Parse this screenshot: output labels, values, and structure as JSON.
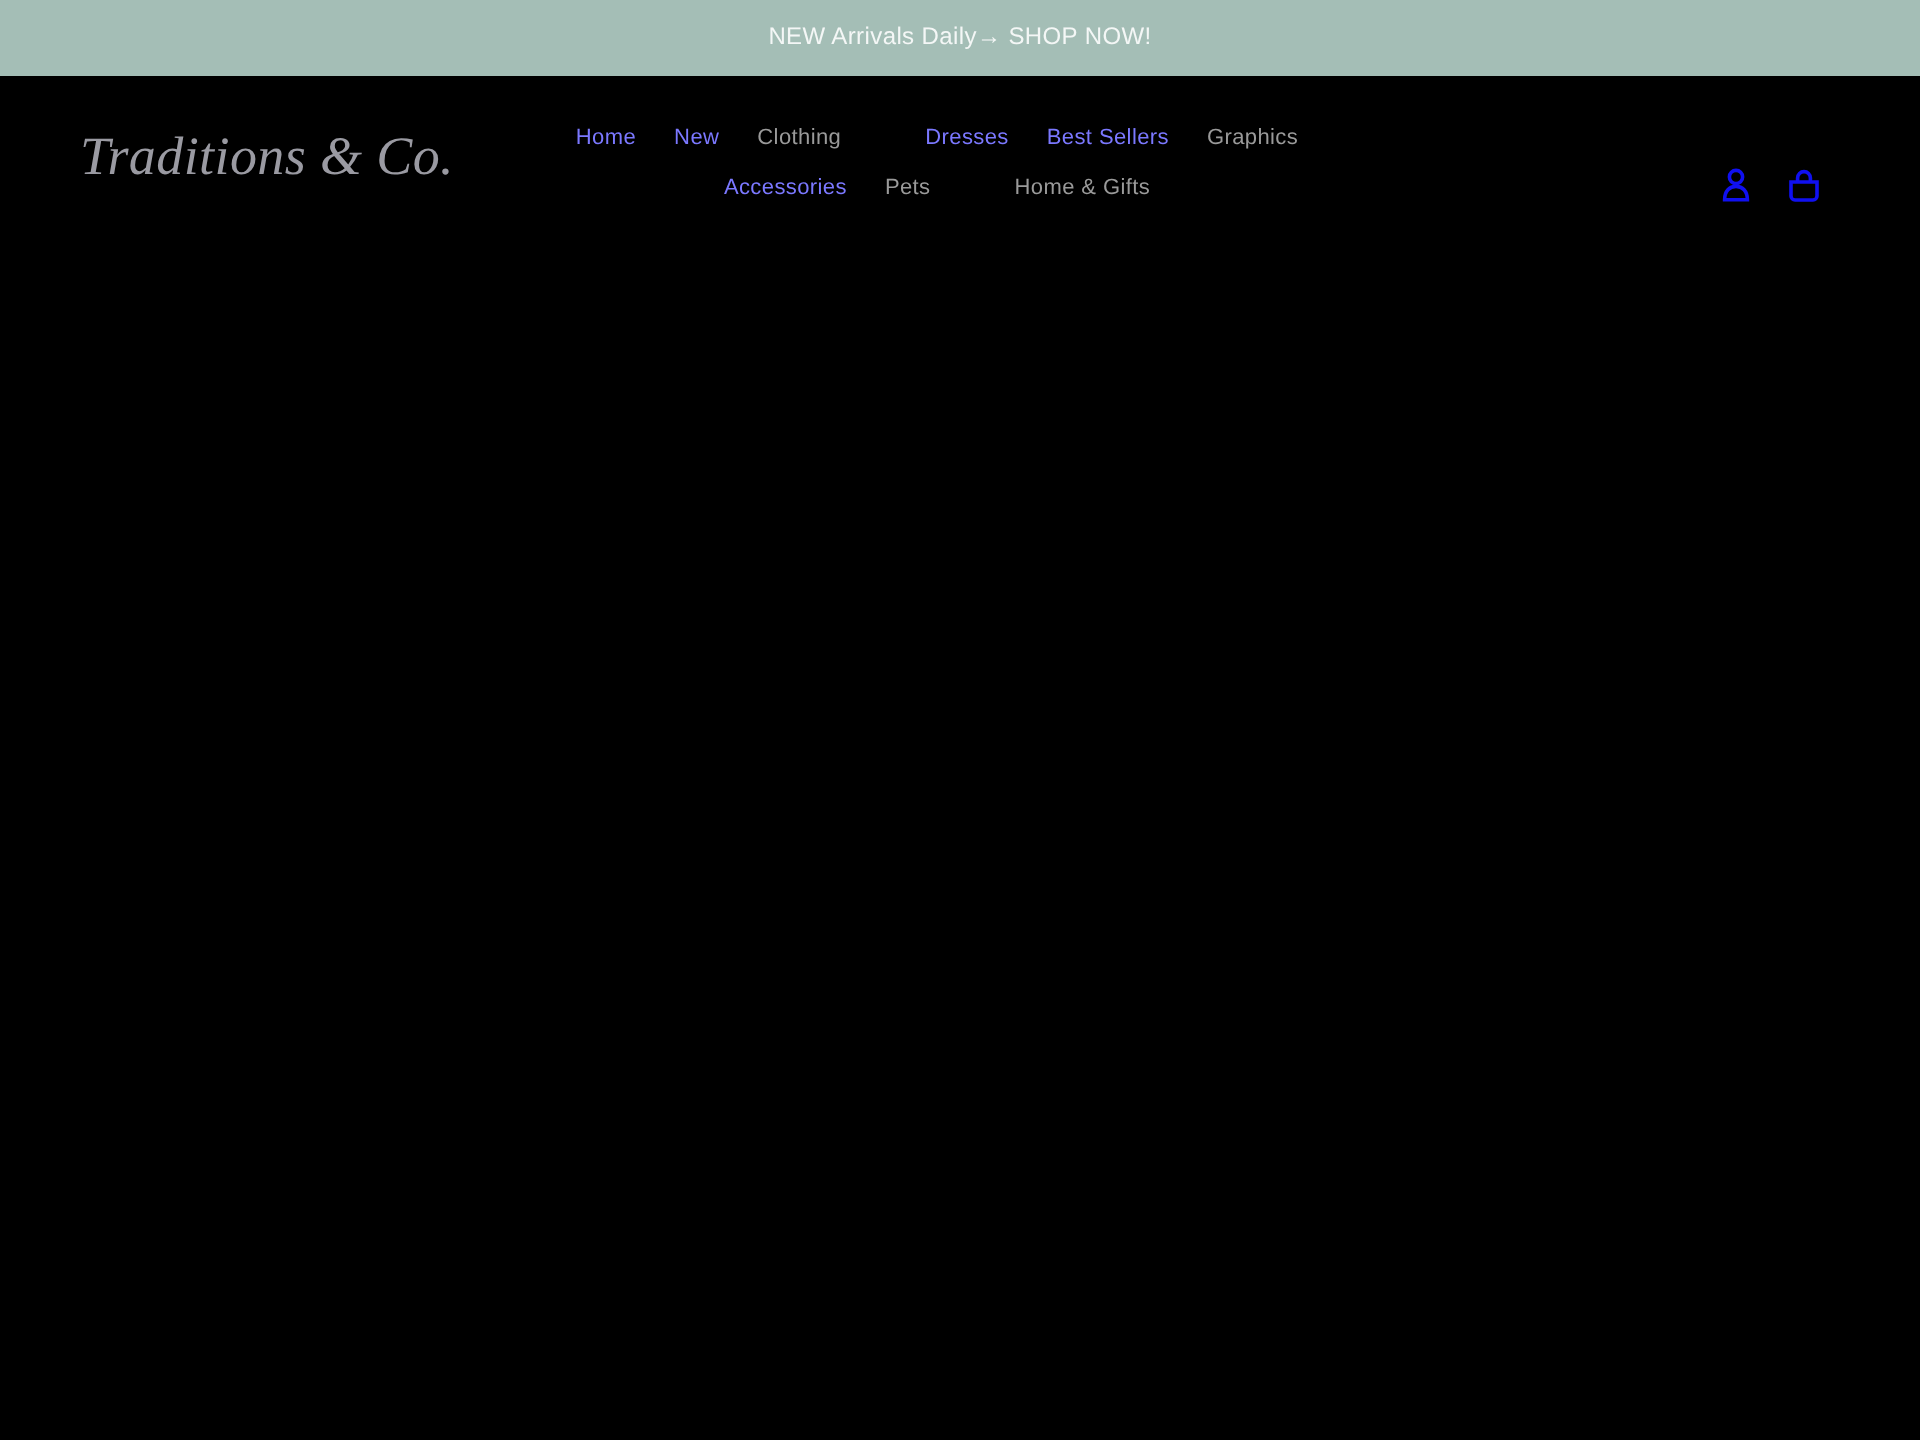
{
  "announcement": {
    "text": "NEW Arrivals Daily→ SHOP NOW!"
  },
  "header": {
    "logo": "Traditions & Co.",
    "nav": [
      {
        "label": "Home",
        "kind": "link"
      },
      {
        "label": "New",
        "kind": "link"
      },
      {
        "label": "Clothing",
        "kind": "dropdown"
      },
      {
        "label": "Dresses",
        "kind": "link"
      },
      {
        "label": "Best Sellers",
        "kind": "link"
      },
      {
        "label": "Graphics",
        "kind": "dropdown"
      },
      {
        "label": "Accessories",
        "kind": "link"
      },
      {
        "label": "Pets",
        "kind": "dropdown"
      },
      {
        "label": "Home & Gifts",
        "kind": "dropdown"
      }
    ]
  }
}
